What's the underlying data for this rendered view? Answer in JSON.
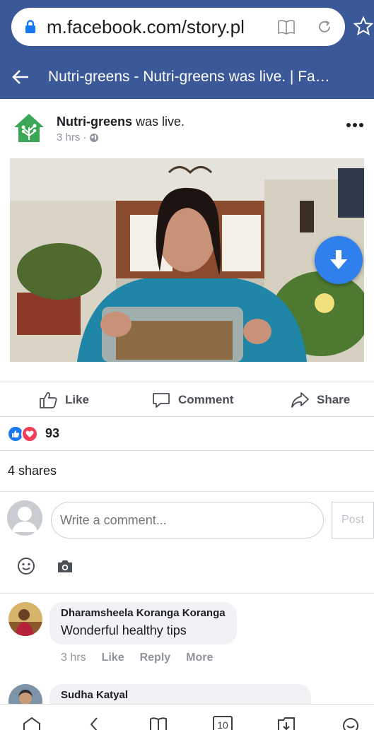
{
  "browser": {
    "url": "m.facebook.com/story.pl",
    "icons": [
      "lock-icon",
      "reader-icon",
      "reload-icon",
      "star-icon"
    ]
  },
  "header": {
    "title": "Nutri-greens - Nutri-greens was live. | Fa…"
  },
  "post": {
    "author": "Nutri-greens",
    "action": " was live.",
    "time": "3 hrs",
    "separator": "·"
  },
  "actions": {
    "like": "Like",
    "comment": "Comment",
    "share": "Share"
  },
  "reactions": {
    "count": "93"
  },
  "shares": "4 shares",
  "composer": {
    "placeholder": "Write a comment...",
    "post_label": "Post"
  },
  "comments": [
    {
      "name": "Dharamsheela Koranga Koranga",
      "text": "Wonderful healthy tips",
      "time": "3 hrs",
      "like": "Like",
      "reply": "Reply",
      "more": "More"
    },
    {
      "name": "Sudha Katyal"
    }
  ],
  "bottom_nav": {
    "tab_count": "10"
  },
  "colors": {
    "brand": "#3b5998",
    "fab": "#2f80ed",
    "like": "#1877f2",
    "love": "#f33e58"
  }
}
